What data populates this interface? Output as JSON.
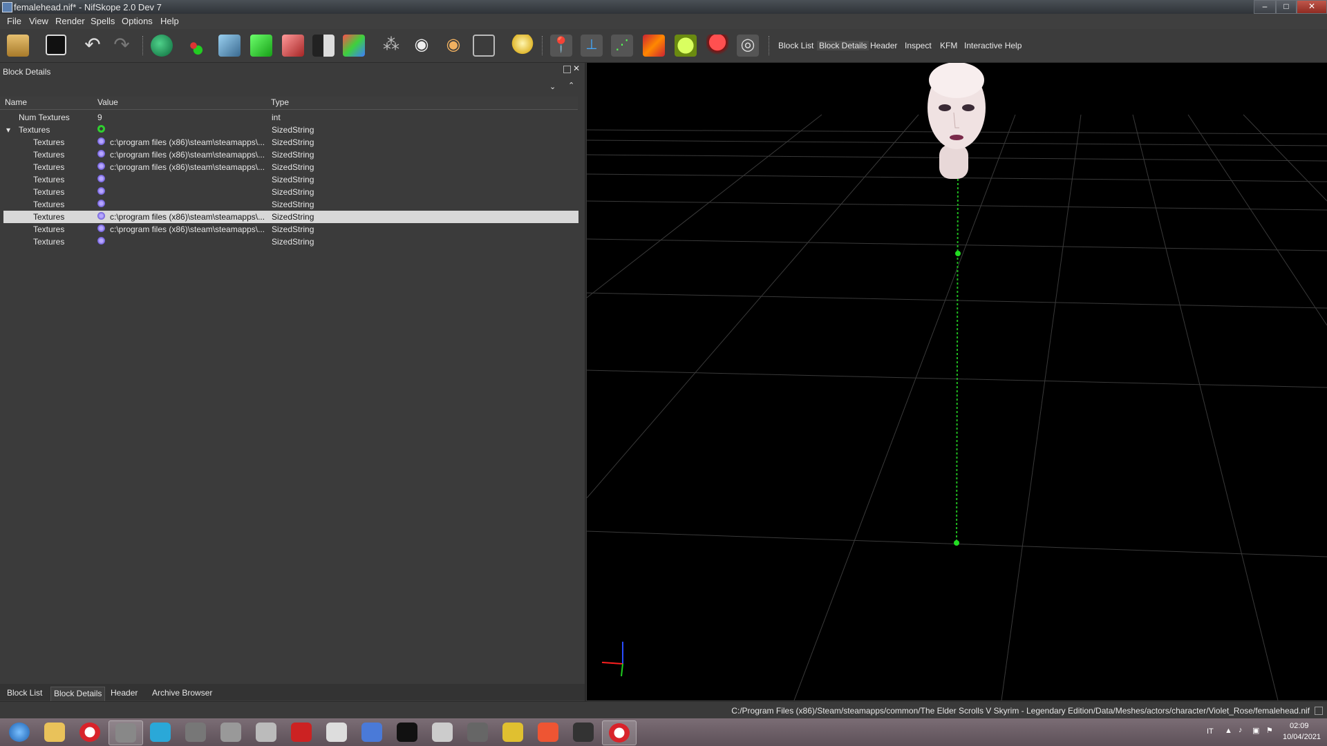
{
  "window": {
    "title": "femalehead.nif* - NifSkope 2.0 Dev 7",
    "min": "‒",
    "max": "□",
    "close": "✕"
  },
  "menu": [
    "File",
    "View",
    "Render",
    "Spells",
    "Options",
    "Help"
  ],
  "toolbar": {
    "icons": [
      "open-icon",
      "save-icon",
      "undo-icon",
      "redo-icon",
      "select-object-icon",
      "select-vertex-icon",
      "shade-flat-icon",
      "shade-green-icon",
      "shade-red-icon",
      "toggle-shading-icon",
      "texture-cube-icon",
      "walk-icon",
      "visibility-icon",
      "hidden-icon",
      "screenshot-icon",
      "light-icon",
      "pin-icon",
      "axes-icon",
      "nodes-icon",
      "collision-icon",
      "scene-icon",
      "marker-icon",
      "eye-icon"
    ],
    "tabs": [
      "Block List",
      "Block Details",
      "Header",
      "Inspect",
      "KFM",
      "Interactive Help"
    ]
  },
  "panel": {
    "title": "Block Details",
    "columns": [
      "Name",
      "Value",
      "Type"
    ],
    "rows": [
      {
        "name": "Num Textures",
        "value": "9",
        "type": "int",
        "indent": 0,
        "icon": "none"
      },
      {
        "name": "Textures",
        "value": "",
        "type": "SizedString",
        "indent": 0,
        "icon": "refresh",
        "expanded": true
      },
      {
        "name": "Textures",
        "value": "c:\\program files (x86)\\steam\\steamapps\\...",
        "type": "SizedString",
        "indent": 1,
        "icon": "gear"
      },
      {
        "name": "Textures",
        "value": "c:\\program files (x86)\\steam\\steamapps\\...",
        "type": "SizedString",
        "indent": 1,
        "icon": "gear"
      },
      {
        "name": "Textures",
        "value": "c:\\program files (x86)\\steam\\steamapps\\...",
        "type": "SizedString",
        "indent": 1,
        "icon": "gear"
      },
      {
        "name": "Textures",
        "value": "",
        "type": "SizedString",
        "indent": 1,
        "icon": "gear"
      },
      {
        "name": "Textures",
        "value": "",
        "type": "SizedString",
        "indent": 1,
        "icon": "gear"
      },
      {
        "name": "Textures",
        "value": "",
        "type": "SizedString",
        "indent": 1,
        "icon": "gear"
      },
      {
        "name": "Textures",
        "value": "c:\\program files (x86)\\steam\\steamapps\\...",
        "type": "SizedString",
        "indent": 1,
        "icon": "gear",
        "selected": true
      },
      {
        "name": "Textures",
        "value": "c:\\program files (x86)\\steam\\steamapps\\...",
        "type": "SizedString",
        "indent": 1,
        "icon": "gear"
      },
      {
        "name": "Textures",
        "value": "",
        "type": "SizedString",
        "indent": 1,
        "icon": "gear"
      }
    ]
  },
  "bottom_tabs": [
    "Block List",
    "Block Details",
    "Header",
    "Archive Browser"
  ],
  "status": {
    "path": "C:/Program Files (x86)/Steam/steamapps/common/The Elder Scrolls V Skyrim - Legendary Edition/Data/Meshes/actors/character/Violet_Rose/femalehead.nif"
  },
  "taskbar": {
    "apps": [
      "start-orb",
      "explorer-icon",
      "opera-icon",
      "game-icon",
      "music-icon",
      "volume-app-icon",
      "ffdec-icon",
      "feather-icon",
      "spider-icon",
      "figures-icon",
      "headphones-icon",
      "nmm-icon",
      "window-icon",
      "arrow-icon",
      "archive-icon",
      "f-icon",
      "creation-icon",
      "opera-icon"
    ],
    "lang": "IT",
    "time": "02:09",
    "date": "10/04/2021"
  },
  "colors": {
    "panel_bg": "#3b3b3b",
    "selection": "#d8d8d8",
    "grid": "#3c3c3c",
    "green_line": "#1fb81f"
  }
}
